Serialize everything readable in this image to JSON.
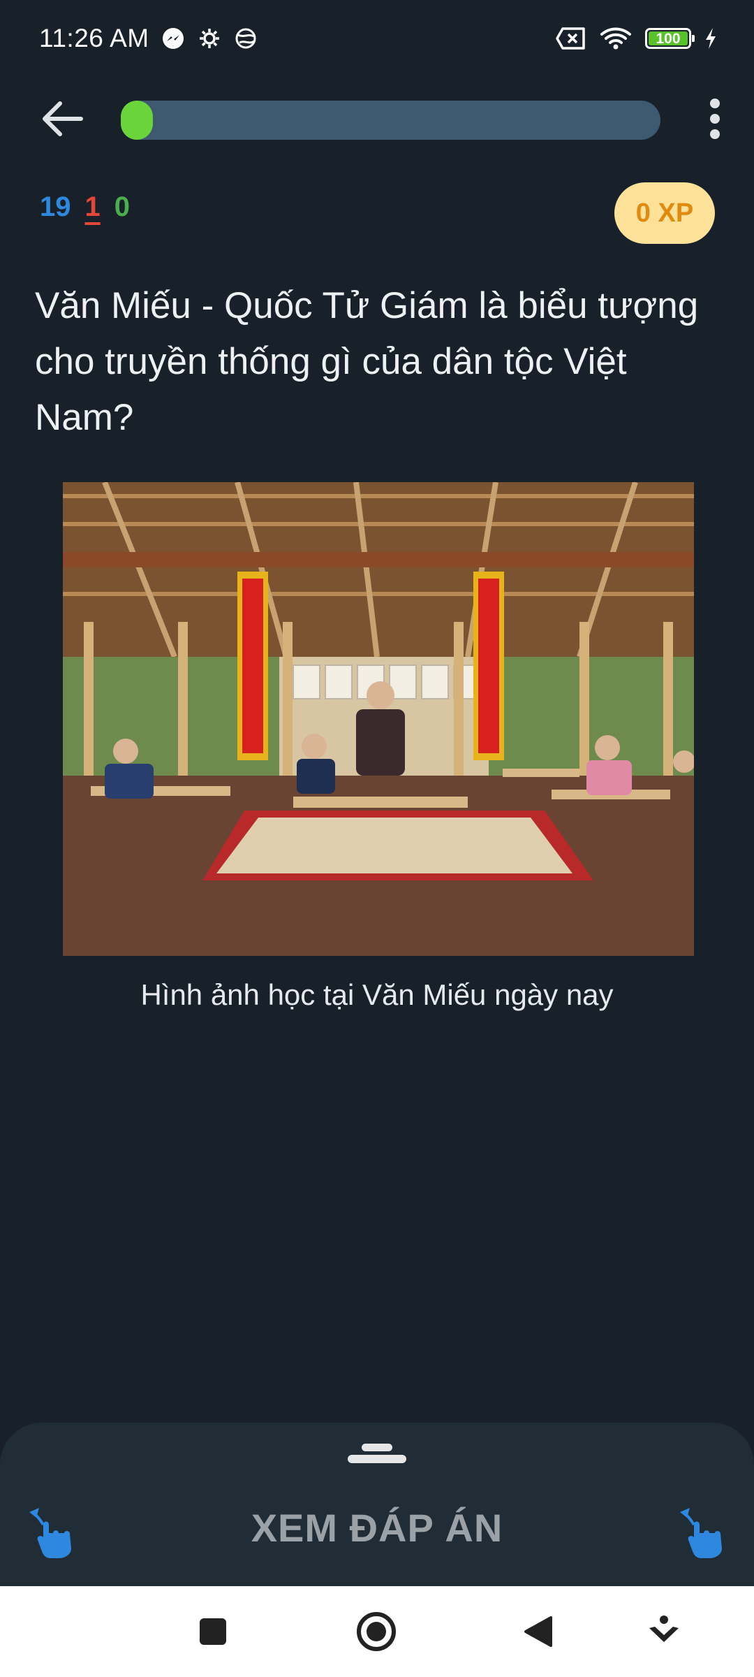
{
  "status_bar": {
    "time": "11:26 AM",
    "battery_level": "100",
    "battery_fraction": 1.0,
    "left_icons": [
      "messenger-icon",
      "settings-gear-icon",
      "vpn-globe-icon"
    ],
    "right_icons": [
      "no-sim-icon",
      "wifi-icon",
      "battery-icon",
      "charging-bolt-icon"
    ]
  },
  "header": {
    "progress_fraction": 0.06,
    "icons": [
      "back-arrow-icon",
      "more-vertical-icon"
    ]
  },
  "stats": {
    "blue_count": "19",
    "red_count": "1",
    "green_count": "0",
    "xp_label": "0 XP"
  },
  "question": {
    "text": "Văn Miếu - Quốc Tử Giám là biểu tượng cho truyền thống gì của dân tộc Việt Nam?"
  },
  "image": {
    "caption": "Hình ảnh học tại Văn Miếu ngày nay"
  },
  "bottom_sheet": {
    "answer_button_label": "XEM ĐÁP ÁN",
    "icons": [
      "drag-handle-icon",
      "swipe-left-hand-icon",
      "swipe-right-hand-icon"
    ]
  },
  "navigation": {
    "icons": [
      "recents-square-icon",
      "home-circle-icon",
      "back-triangle-icon",
      "notification-pull-icon"
    ]
  },
  "colors": {
    "background": "#18212a",
    "progress_track": "#3d5a70",
    "progress_fill": "#6bd43a",
    "xp_badge_bg": "#ffe29a",
    "xp_badge_text": "#e08a0e",
    "count_blue": "#2e88e0",
    "count_red": "#e5463a",
    "count_green": "#4cae4f",
    "sheet_bg": "#202c36",
    "swipe_icon": "#2e88e0"
  }
}
